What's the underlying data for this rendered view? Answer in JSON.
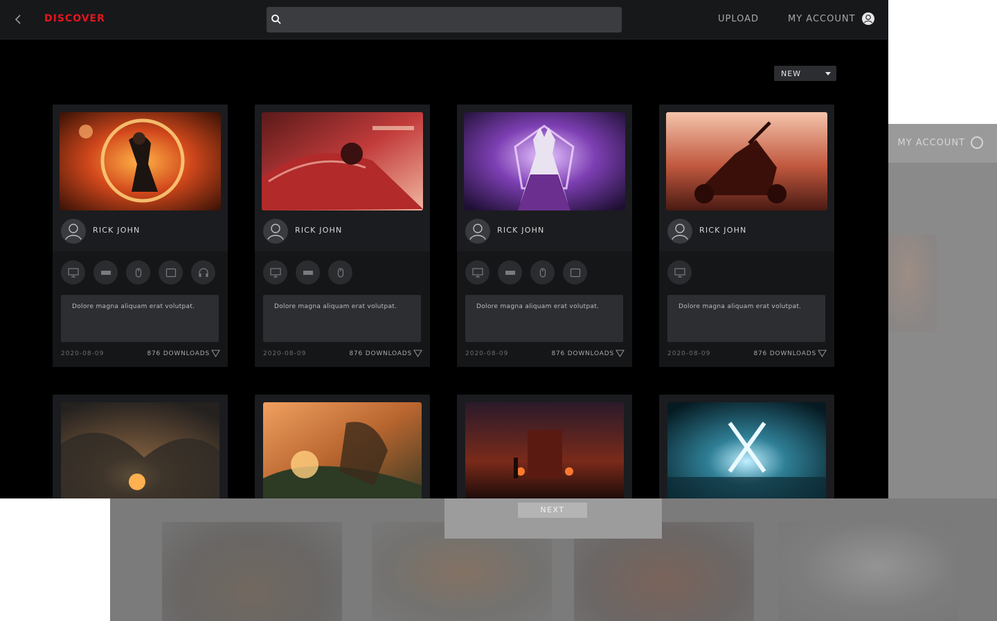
{
  "header": {
    "brand": "DISCOVER",
    "search_placeholder": "",
    "upload_label": "UPLOAD",
    "account_label": "MY ACCOUNT"
  },
  "sort": {
    "selected": "NEW"
  },
  "background_window": {
    "account_label": "MY ACCOUNT",
    "next_label": "NEXT"
  },
  "cards": [
    {
      "user": "RICK JOHN",
      "devices": [
        "monitor-icon",
        "keyboard-icon",
        "mouse-icon",
        "tablet-icon",
        "headset-icon"
      ],
      "description": "Dolore magna aliquam erat volutpat.",
      "date": "2020-08-09",
      "downloads": "876 DOWNLOADS"
    },
    {
      "user": "RICK JOHN",
      "devices": [
        "monitor-icon",
        "keyboard-icon",
        "mouse-icon"
      ],
      "description": "Dolore magna aliquam erat volutpat.",
      "date": "2020-08-09",
      "downloads": "876 DOWNLOADS"
    },
    {
      "user": "RICK JOHN",
      "devices": [
        "monitor-icon",
        "keyboard-icon",
        "mouse-icon",
        "tablet-icon"
      ],
      "description": "Dolore magna aliquam erat volutpat.",
      "date": "2020-08-09",
      "downloads": "876 DOWNLOADS"
    },
    {
      "user": "RICK JOHN",
      "devices": [
        "monitor-icon"
      ],
      "description": "Dolore magna aliquam erat volutpat.",
      "date": "2020-08-09",
      "downloads": "876 DOWNLOADS"
    }
  ],
  "colors": {
    "brand": "#e4161f",
    "background": "#000000",
    "card": "#1b1c1f",
    "panel": "#2c2e32"
  }
}
